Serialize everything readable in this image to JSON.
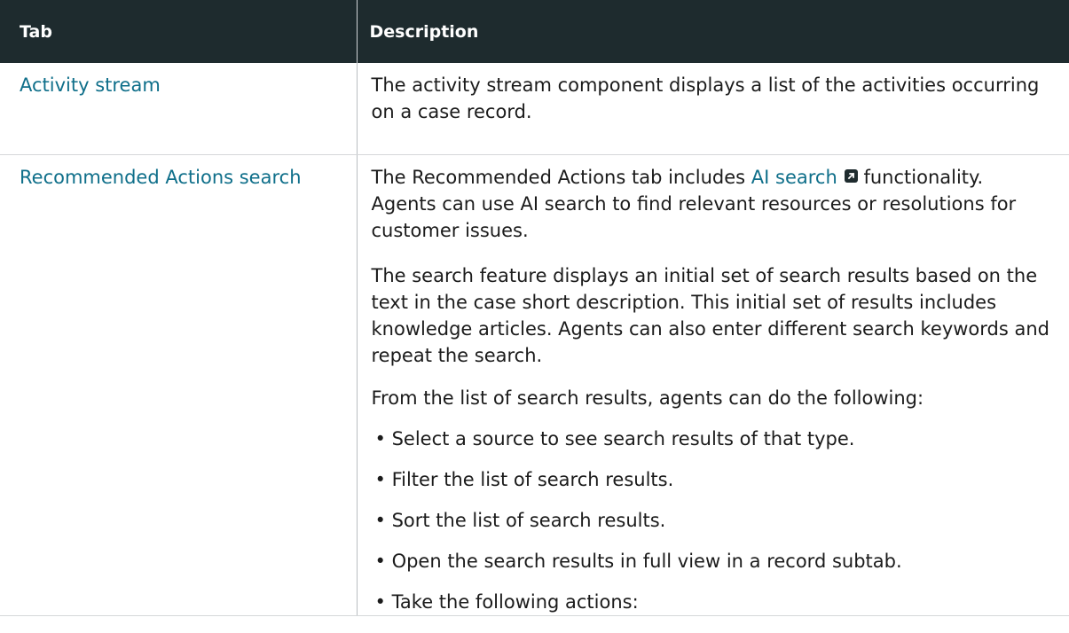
{
  "table": {
    "headers": {
      "tab": "Tab",
      "description": "Description"
    },
    "rows": [
      {
        "tab": "Activity stream",
        "description": "The activity stream component displays a list of the activities occurring on a case record."
      },
      {
        "tab": "Recommended Actions search",
        "description_intro_before_link": "The Recommended Actions tab includes ",
        "description_link": "AI search",
        "description_link_icon": "external-link-icon",
        "description_intro_after_link": " functionality. Agents can use AI search to find relevant resources or resolutions for customer issues.",
        "paragraph_2": "The search feature displays an initial set of search results based on the text in the case short description. This initial set of results includes knowledge articles. Agents can also enter different search keywords and repeat the search.",
        "list_intro": "From the list of search results, agents can do the following:",
        "bullets": [
          "Select a source to see search results of that type.",
          "Filter the list of search results.",
          "Sort the list of search results.",
          "Open the search results in full view in a record subtab.",
          "Take the following actions:"
        ]
      }
    ]
  },
  "colors": {
    "header_bg": "#1e2b2e",
    "link": "#0f6f8a",
    "text": "#1b1b1b"
  }
}
